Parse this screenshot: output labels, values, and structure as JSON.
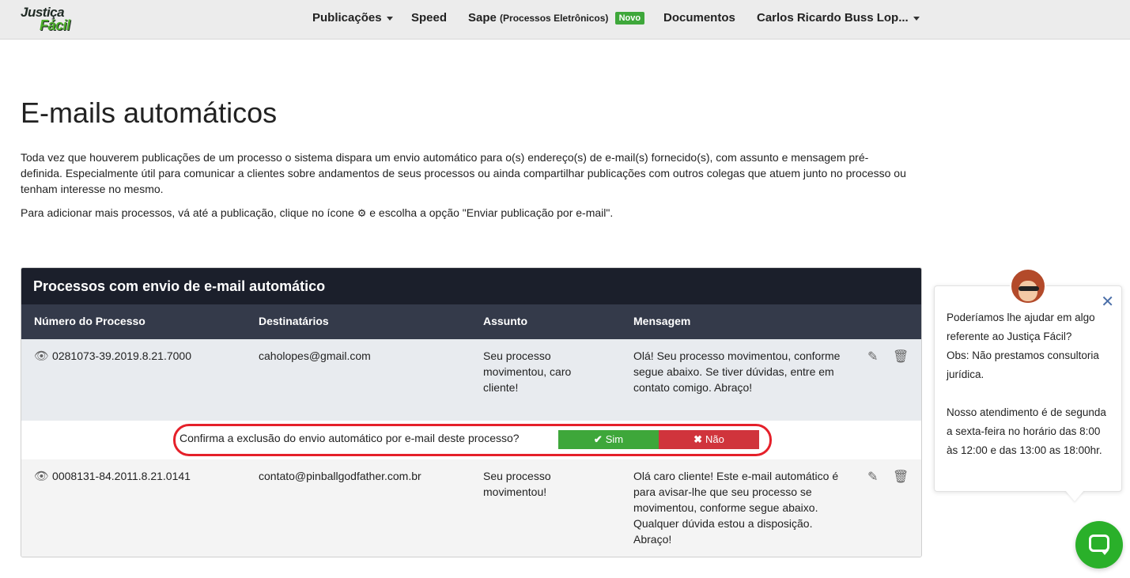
{
  "navbar": {
    "logo_line1": "Justiça",
    "logo_line2": "Fácil",
    "publicacoes": "Publicações",
    "speed": "Speed",
    "sape": "Sape",
    "sape_sub": "(Processos Eletrônicos)",
    "novo_badge": "Novo",
    "documentos": "Documentos",
    "user": "Carlos Ricardo Buss Lop..."
  },
  "page": {
    "title": "E-mails automáticos",
    "intro": "Toda vez que houverem publicações de um processo o sistema dispara um envio automático para o(s) endereço(s) de e-mail(s) fornecido(s), com assunto e mensagem pré-definida. Especialmente útil para comunicar a clientes sobre andamentos de seus processos ou ainda compartilhar publicações com outros colegas que atuem junto no processo ou tenham interesse no mesmo.",
    "intro2_before": "Para adicionar mais processos, vá até a publicação, clique no ícone",
    "intro2_after": "e escolha a opção \"Enviar publicação por e-mail\"."
  },
  "panel": {
    "title": "Processos com envio de e-mail automático",
    "headers": {
      "numero": "Número do Processo",
      "destinatarios": "Destinatários",
      "assunto": "Assunto",
      "mensagem": "Mensagem"
    },
    "rows": [
      {
        "numero": "0281073-39.2019.8.21.7000",
        "destinatarios": "caholopes@gmail.com",
        "assunto": "Seu processo movimentou, caro cliente!",
        "mensagem": "Olá! Seu processo movimentou, conforme segue abaixo. Se tiver dúvidas, entre em contato comigo. Abraço!"
      },
      {
        "numero": "0008131-84.2011.8.21.0141",
        "destinatarios": "contato@pinballgodfather.com.br",
        "assunto": "Seu processo movimentou!",
        "mensagem": "Olá caro cliente! Este e-mail automático é para avisar-lhe que seu processo se movimentou, conforme segue abaixo. Qualquer dúvida estou a disposição. Abraço!"
      }
    ],
    "confirm": {
      "text": "Confirma a exclusão do envio automático por e-mail deste processo?",
      "yes": "Sim",
      "no": "Não"
    }
  },
  "chat": {
    "line1": "Poderíamos lhe ajudar em algo referente ao Justiça Fácil?",
    "line2": "Obs: Não prestamos consultoria jurídica.",
    "line3": "Nosso atendimento é de segunda a sexta-feira no horário das 8:00 às 12:00 e das 13:00 as 18:00hr."
  },
  "colors": {
    "navbar_bg": "#ececec",
    "panel_header": "#1b1f2b",
    "table_header": "#343a4a",
    "success": "#3ea73a",
    "danger": "#d0343c",
    "highlight": "#e5202a",
    "chat_button": "#2ab02a"
  },
  "icons": [
    "eye-icon",
    "edit-icon",
    "trash-icon",
    "gear-icon",
    "check-icon",
    "times-icon",
    "close-icon",
    "chat-icon"
  ]
}
